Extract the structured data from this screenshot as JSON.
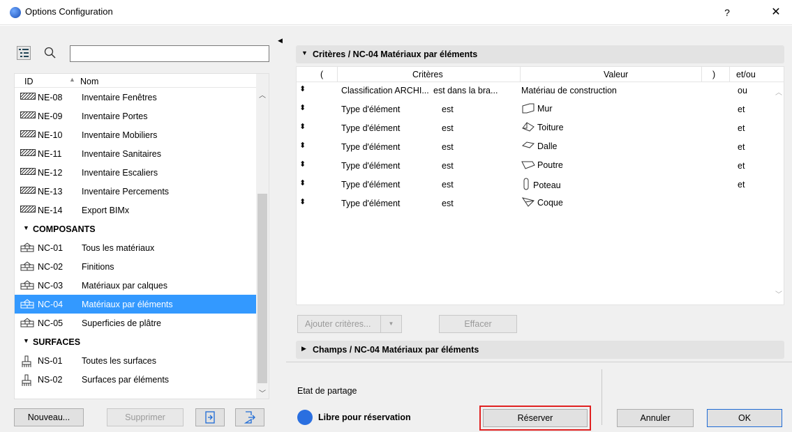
{
  "window": {
    "title": "Options Configuration",
    "help": "?",
    "close": "✕"
  },
  "search": {
    "value": "",
    "placeholder": ""
  },
  "list": {
    "header_id": "ID",
    "header_nom": "Nom",
    "rows": [
      {
        "type": "item",
        "icon": "hatch",
        "id": "NE-08",
        "name": "Inventaire Fenêtres"
      },
      {
        "type": "item",
        "icon": "hatch",
        "id": "NE-09",
        "name": "Inventaire Portes"
      },
      {
        "type": "item",
        "icon": "hatch",
        "id": "NE-10",
        "name": "Inventaire Mobiliers"
      },
      {
        "type": "item",
        "icon": "hatch",
        "id": "NE-11",
        "name": "Inventaire Sanitaires"
      },
      {
        "type": "item",
        "icon": "hatch",
        "id": "NE-12",
        "name": "Inventaire Escaliers"
      },
      {
        "type": "item",
        "icon": "hatch",
        "id": "NE-13",
        "name": "Inventaire Percements"
      },
      {
        "type": "item",
        "icon": "hatch",
        "id": "NE-14",
        "name": "Export BIMx"
      },
      {
        "type": "group",
        "name": "COMPOSANTS"
      },
      {
        "type": "item",
        "icon": "brick",
        "id": "NC-01",
        "name": "Tous les matériaux"
      },
      {
        "type": "item",
        "icon": "brick",
        "id": "NC-02",
        "name": "Finitions"
      },
      {
        "type": "item",
        "icon": "brick",
        "id": "NC-03",
        "name": "Matériaux par calques"
      },
      {
        "type": "item",
        "icon": "brick",
        "id": "NC-04",
        "name": "Matériaux par éléments",
        "selected": true
      },
      {
        "type": "item",
        "icon": "brick",
        "id": "NC-05",
        "name": "Superficies de plâtre"
      },
      {
        "type": "group",
        "name": "SURFACES"
      },
      {
        "type": "item",
        "icon": "brush",
        "id": "NS-01",
        "name": "Toutes les surfaces"
      },
      {
        "type": "item",
        "icon": "brush",
        "id": "NS-02",
        "name": "Surfaces par éléments"
      }
    ]
  },
  "left_buttons": {
    "new": "Nouveau...",
    "delete": "Supprimer"
  },
  "criteria_section": {
    "title": "Critères / NC-04 Matériaux par éléments",
    "headers": {
      "open": "(",
      "criteria": "Critères",
      "value": "Valeur",
      "close": ")",
      "andor": "et/ou"
    },
    "rows": [
      {
        "criterion": "Classification ARCHI...",
        "op": "est dans la bra...",
        "icon": "",
        "value": "Matériau de construction",
        "andor": "ou"
      },
      {
        "criterion": "Type d'élément",
        "op": "est",
        "icon": "wall",
        "value": "Mur",
        "andor": "et"
      },
      {
        "criterion": "Type d'élément",
        "op": "est",
        "icon": "roof",
        "value": "Toiture",
        "andor": "et"
      },
      {
        "criterion": "Type d'élément",
        "op": "est",
        "icon": "slab",
        "value": "Dalle",
        "andor": "et"
      },
      {
        "criterion": "Type d'élément",
        "op": "est",
        "icon": "beam",
        "value": "Poutre",
        "andor": "et"
      },
      {
        "criterion": "Type d'élément",
        "op": "est",
        "icon": "column",
        "value": "Poteau",
        "andor": "et"
      },
      {
        "criterion": "Type d'élément",
        "op": "est",
        "icon": "shell",
        "value": "Coque",
        "andor": ""
      }
    ],
    "add_button": "Ajouter critères...",
    "clear_button": "Effacer"
  },
  "fields_section": {
    "title": "Champs / NC-04 Matériaux par éléments"
  },
  "sharing": {
    "label": "Etat de partage",
    "status": "Libre pour réservation",
    "status_color": "#2a6fe0",
    "reserve": "Réserver",
    "cancel": "Annuler",
    "ok": "OK"
  },
  "colors": {
    "selection": "#3399ff",
    "highlight_border": "#e02020"
  }
}
